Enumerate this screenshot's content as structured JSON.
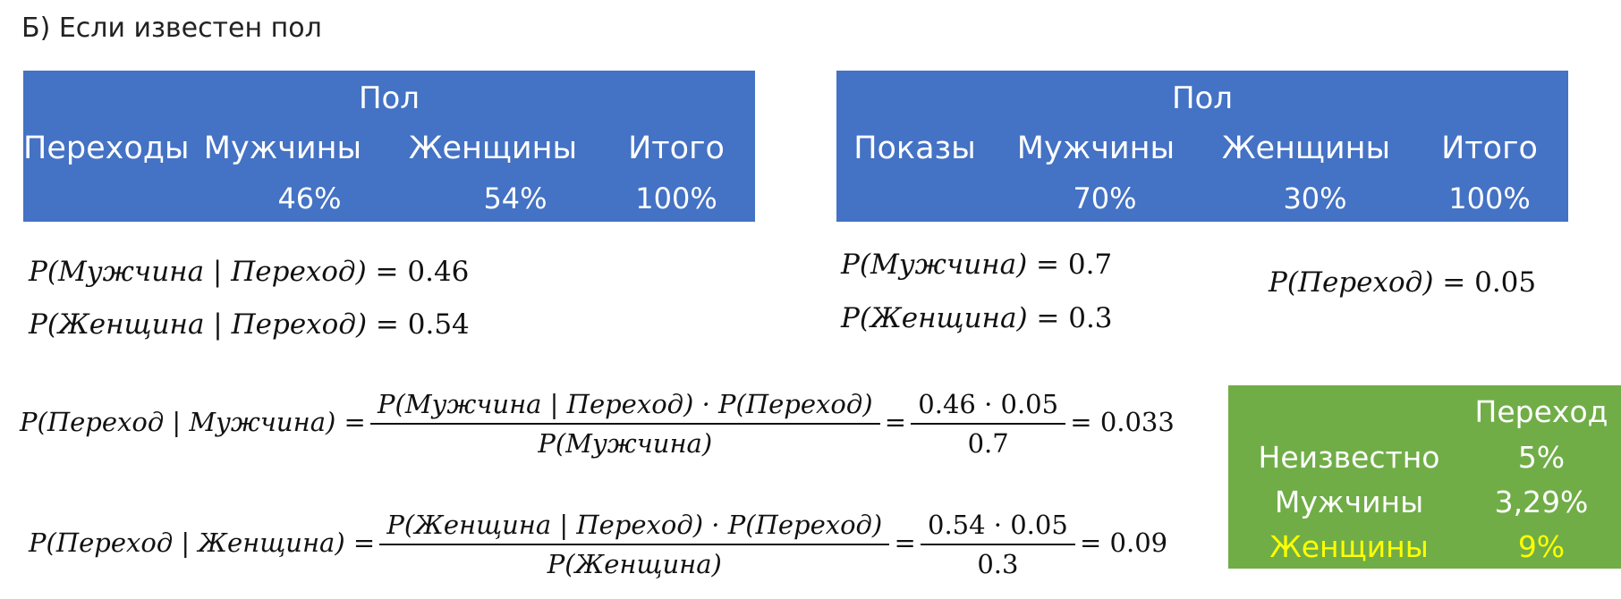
{
  "heading": "Б) Если известен пол",
  "table_clicks": {
    "title": "Пол",
    "row_label": "Переходы",
    "columns": [
      "Мужчины",
      "Женщины",
      "Итого"
    ],
    "values": [
      "46%",
      "54%",
      "100%"
    ]
  },
  "table_shows": {
    "title": "Пол",
    "row_label": "Показы",
    "columns": [
      "Мужчины",
      "Женщины",
      "Итого"
    ],
    "values": [
      "70%",
      "30%",
      "100%"
    ]
  },
  "formulas": {
    "p_man_given_click": {
      "lhs": "P(Мужчина | Переход)",
      "rhs": "= 0.46"
    },
    "p_woman_given_click": {
      "lhs": "P(Женщина | Переход)",
      "rhs": "= 0.54"
    },
    "p_man": {
      "lhs": "P(Мужчина)",
      "rhs": "= 0.7"
    },
    "p_woman": {
      "lhs": "P(Женщина)",
      "rhs": "= 0.3"
    },
    "p_click": {
      "lhs": "P(Переход)",
      "rhs": "= 0.05"
    },
    "bayes_man": {
      "lhs": "P(Переход | Мужчина) =",
      "num": "P(Мужчина | Переход) · P(Переход)",
      "den": "P(Мужчина)",
      "eq1": "=",
      "num2": "0.46 · 0.05",
      "den2": "0.7",
      "result": "= 0.033"
    },
    "bayes_woman": {
      "lhs": "P(Переход | Женщина) =",
      "num": "P(Женщина | Переход) · P(Переход)",
      "den": "P(Женщина)",
      "eq1": "=",
      "num2": "0.54 · 0.05",
      "den2": "0.3",
      "result": "= 0.09"
    }
  },
  "summary": {
    "header": "Переход",
    "rows": [
      {
        "label": "Неизвестно",
        "value": "5%"
      },
      {
        "label": "Мужчины",
        "value": "3,29%"
      },
      {
        "label": "Женщины",
        "value": "9%"
      }
    ],
    "highlight_color": "#ffff00",
    "background": "#70ad47"
  }
}
